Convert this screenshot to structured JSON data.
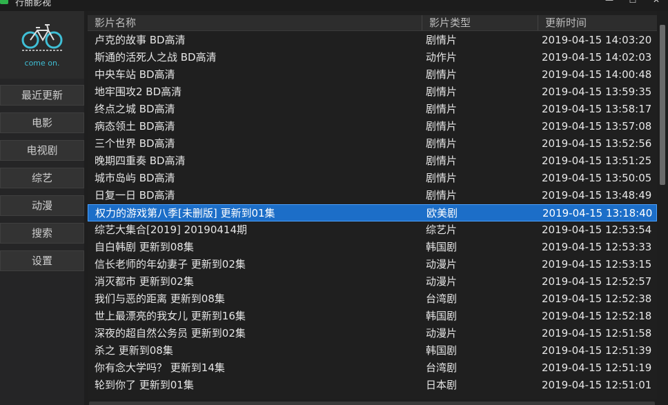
{
  "window": {
    "title": "行丽影视",
    "minimize": "—",
    "maximize": "☐",
    "close": "✕"
  },
  "logo": {
    "text": "come on.",
    "icon": "bicycle-icon",
    "accent": "#3fbfd6"
  },
  "sidebar": {
    "items": [
      {
        "label": "最近更新"
      },
      {
        "label": "电影"
      },
      {
        "label": "电视剧"
      },
      {
        "label": "综艺"
      },
      {
        "label": "动漫"
      },
      {
        "label": "搜索"
      },
      {
        "label": "设置"
      }
    ]
  },
  "table": {
    "columns": [
      "影片名称",
      "影片类型",
      "更新时间"
    ],
    "rows": [
      {
        "name": "卢克的故事 BD高清",
        "type": "剧情片",
        "time": "2019-04-15 14:03:20"
      },
      {
        "name": "斯通的活死人之战 BD高清",
        "type": "动作片",
        "time": "2019-04-15 14:02:03"
      },
      {
        "name": "中央车站 BD高清",
        "type": "剧情片",
        "time": "2019-04-15 14:00:48"
      },
      {
        "name": "地牢围攻2 BD高清",
        "type": "剧情片",
        "time": "2019-04-15 13:59:35"
      },
      {
        "name": "终点之城 BD高清",
        "type": "剧情片",
        "time": "2019-04-15 13:58:17"
      },
      {
        "name": "病态领土 BD高清",
        "type": "剧情片",
        "time": "2019-04-15 13:57:08"
      },
      {
        "name": "三个世界 BD高清",
        "type": "剧情片",
        "time": "2019-04-15 13:52:56"
      },
      {
        "name": "晚期四重奏 BD高清",
        "type": "剧情片",
        "time": "2019-04-15 13:51:25"
      },
      {
        "name": "城市岛屿 BD高清",
        "type": "剧情片",
        "time": "2019-04-15 13:50:05"
      },
      {
        "name": "日复一日 BD高清",
        "type": "剧情片",
        "time": "2019-04-15 13:48:49"
      },
      {
        "name": "权力的游戏第八季[未删版] 更新到01集",
        "type": "欧美剧",
        "time": "2019-04-15 13:18:40",
        "selected": true
      },
      {
        "name": "综艺大集合[2019] 20190414期",
        "type": "综艺片",
        "time": "2019-04-15 12:53:54"
      },
      {
        "name": "自白韩剧 更新到08集",
        "type": "韩国剧",
        "time": "2019-04-15 12:53:33"
      },
      {
        "name": "信长老师的年幼妻子 更新到02集",
        "type": "动漫片",
        "time": "2019-04-15 12:53:15"
      },
      {
        "name": "消灭都市 更新到02集",
        "type": "动漫片",
        "time": "2019-04-15 12:52:57"
      },
      {
        "name": "我们与恶的距离 更新到08集",
        "type": "台湾剧",
        "time": "2019-04-15 12:52:38"
      },
      {
        "name": "世上最漂亮的我女儿 更新到16集",
        "type": "韩国剧",
        "time": "2019-04-15 12:52:18"
      },
      {
        "name": "深夜的超自然公务员 更新到02集",
        "type": "动漫片",
        "time": "2019-04-15 12:51:58"
      },
      {
        "name": "杀之 更新到08集",
        "type": "韩国剧",
        "time": "2019-04-15 12:51:39"
      },
      {
        "name": "你有念大学吗？ 更新到14集",
        "type": "台湾剧",
        "time": "2019-04-15 12:51:19"
      },
      {
        "name": "轮到你了 更新到01集",
        "type": "日本剧",
        "time": "2019-04-15 12:51:01"
      }
    ]
  },
  "colors": {
    "selection": "#1c6ec8",
    "background": "#1f1f1f"
  }
}
